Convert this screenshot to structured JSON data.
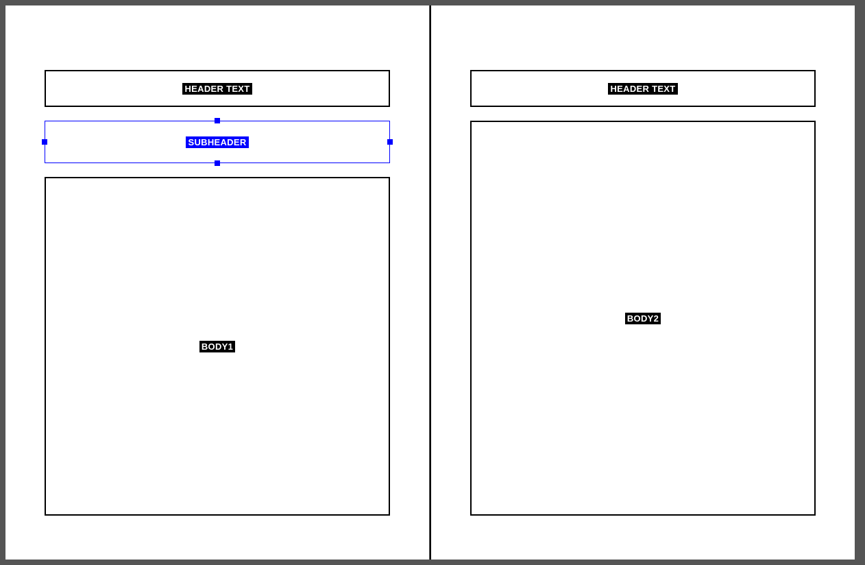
{
  "pages": [
    {
      "frames": {
        "header": {
          "label": "HEADER TEXT",
          "selected": false
        },
        "subheader": {
          "label": "SUBHEADER",
          "selected": true
        },
        "body": {
          "label": "BODY1",
          "selected": false
        }
      }
    },
    {
      "frames": {
        "header": {
          "label": "HEADER TEXT",
          "selected": false
        },
        "body": {
          "label": "BODY2",
          "selected": false
        }
      }
    }
  ],
  "colors": {
    "selection": "#0000FF",
    "frame_border": "#000000",
    "label_bg": "#000000",
    "label_text": "#FFFFFF",
    "canvas_bg": "#555555",
    "page_bg": "#FFFFFF"
  }
}
